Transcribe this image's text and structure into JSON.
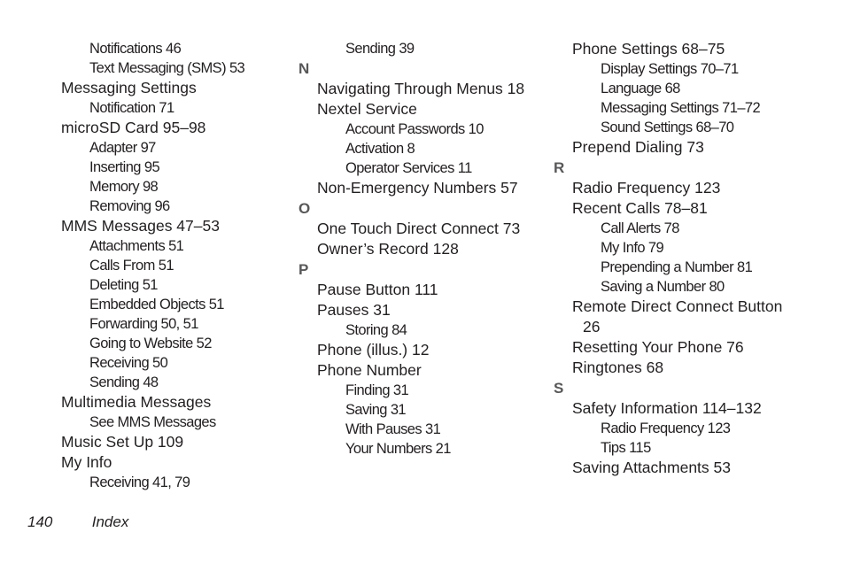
{
  "columns": [
    {
      "entries": [
        {
          "type": "sub",
          "text": "Notifications 46"
        },
        {
          "type": "sub",
          "text": "Text Messaging (SMS) 53"
        },
        {
          "type": "main",
          "text": "Messaging Settings"
        },
        {
          "type": "sub",
          "text": "Notification 71"
        },
        {
          "type": "main",
          "text": "microSD Card 95–98"
        },
        {
          "type": "sub",
          "text": "Adapter 97"
        },
        {
          "type": "sub",
          "text": "Inserting 95"
        },
        {
          "type": "sub",
          "text": "Memory 98"
        },
        {
          "type": "sub",
          "text": "Removing 96"
        },
        {
          "type": "main",
          "text": "MMS Messages 47–53"
        },
        {
          "type": "sub",
          "text": "Attachments 51"
        },
        {
          "type": "sub",
          "text": "Calls From 51"
        },
        {
          "type": "sub",
          "text": "Deleting 51"
        },
        {
          "type": "sub",
          "text": "Embedded Objects 51"
        },
        {
          "type": "sub",
          "text": "Forwarding 50, 51"
        },
        {
          "type": "sub",
          "text": "Going to Website 52"
        },
        {
          "type": "sub",
          "text": "Receiving 50"
        },
        {
          "type": "sub",
          "text": "Sending 48"
        },
        {
          "type": "main",
          "text": "Multimedia Messages"
        },
        {
          "type": "sub",
          "text": "See MMS Messages"
        },
        {
          "type": "main",
          "text": "Music Set Up 109"
        },
        {
          "type": "main",
          "text": "My Info"
        },
        {
          "type": "sub",
          "text": "Receiving 41, 79"
        }
      ]
    },
    {
      "entries": [
        {
          "type": "sub",
          "text": "Sending 39"
        },
        {
          "type": "letter",
          "text": "N"
        },
        {
          "type": "main",
          "text": "Navigating Through Menus 18"
        },
        {
          "type": "main",
          "text": "Nextel Service"
        },
        {
          "type": "sub",
          "text": "Account Passwords 10"
        },
        {
          "type": "sub",
          "text": "Activation 8"
        },
        {
          "type": "sub",
          "text": "Operator Services 11"
        },
        {
          "type": "main",
          "text": "Non-Emergency Numbers 57"
        },
        {
          "type": "letter",
          "text": "O"
        },
        {
          "type": "main",
          "text": "One Touch Direct Connect 73"
        },
        {
          "type": "main",
          "text": "Owner’s Record 128"
        },
        {
          "type": "letter",
          "text": "P"
        },
        {
          "type": "main",
          "text": "Pause Button 111"
        },
        {
          "type": "main",
          "text": "Pauses 31"
        },
        {
          "type": "sub",
          "text": "Storing 84"
        },
        {
          "type": "main",
          "text": "Phone (illus.) 12"
        },
        {
          "type": "main",
          "text": "Phone Number"
        },
        {
          "type": "sub",
          "text": "Finding 31"
        },
        {
          "type": "sub",
          "text": "Saving 31"
        },
        {
          "type": "sub",
          "text": "With Pauses 31"
        },
        {
          "type": "sub",
          "text": "Your Numbers 21"
        }
      ]
    },
    {
      "entries": [
        {
          "type": "main",
          "text": "Phone Settings 68–75"
        },
        {
          "type": "sub",
          "text": "Display Settings 70–71"
        },
        {
          "type": "sub",
          "text": "Language 68"
        },
        {
          "type": "sub",
          "text": "Messaging Settings 71–72"
        },
        {
          "type": "sub",
          "text": "Sound Settings 68–70"
        },
        {
          "type": "main",
          "text": "Prepend Dialing 73"
        },
        {
          "type": "letter",
          "text": "R"
        },
        {
          "type": "main",
          "text": "Radio Frequency 123"
        },
        {
          "type": "main",
          "text": "Recent Calls 78–81"
        },
        {
          "type": "sub",
          "text": "Call Alerts 78"
        },
        {
          "type": "sub",
          "text": "My Info 79"
        },
        {
          "type": "sub",
          "text": "Prepending a Number 81"
        },
        {
          "type": "sub",
          "text": "Saving a Number 80"
        },
        {
          "type": "main",
          "text": "Remote Direct Connect Button"
        },
        {
          "type": "cont",
          "text": "26"
        },
        {
          "type": "main",
          "text": "Resetting Your Phone 76"
        },
        {
          "type": "main",
          "text": "Ringtones 68"
        },
        {
          "type": "letter",
          "text": "S"
        },
        {
          "type": "main",
          "text": "Safety Information 114–132"
        },
        {
          "type": "sub",
          "text": "Radio Frequency 123"
        },
        {
          "type": "sub",
          "text": "Tips 115"
        },
        {
          "type": "main",
          "text": "Saving Attachments 53"
        }
      ]
    }
  ],
  "footer": {
    "page_number": "140",
    "section": "Index"
  },
  "colors": {
    "text": "#231f20",
    "section_letter": "#58585a"
  }
}
